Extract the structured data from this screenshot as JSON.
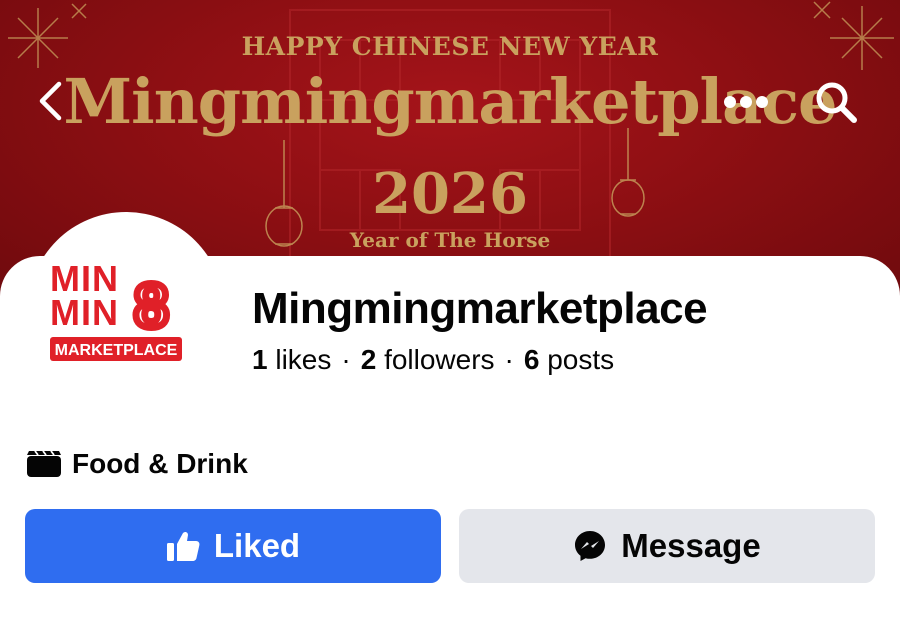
{
  "cover": {
    "greeting": "HAPPY CHINESE NEW YEAR",
    "brand": "Mingmingmarketplace",
    "year": "2026",
    "subtitle": "Year of The Horse",
    "background_color": "#9a1216",
    "text_color": "#c9a15e"
  },
  "top_nav": {
    "back_icon": "chevron-left-icon",
    "more_icon": "more-horizontal-icon",
    "search_icon": "search-icon"
  },
  "avatar_logo": {
    "line1": "MIN",
    "line2": "MIN",
    "digit": "8",
    "badge": "MARKETPLACE",
    "color": "#e02028"
  },
  "profile": {
    "name": "Mingmingmarketplace",
    "likes_count": "1",
    "likes_label": "likes",
    "followers_count": "2",
    "followers_label": "followers",
    "posts_count": "6",
    "posts_label": "posts",
    "separator": "·"
  },
  "category": {
    "icon": "clapperboard-icon",
    "label": "Food & Drink"
  },
  "actions": {
    "liked_label": "Liked",
    "liked_icon": "thumbs-up-icon",
    "liked_color": "#2f6df0",
    "message_label": "Message",
    "message_icon": "messenger-icon",
    "message_color": "#e4e6eb"
  }
}
